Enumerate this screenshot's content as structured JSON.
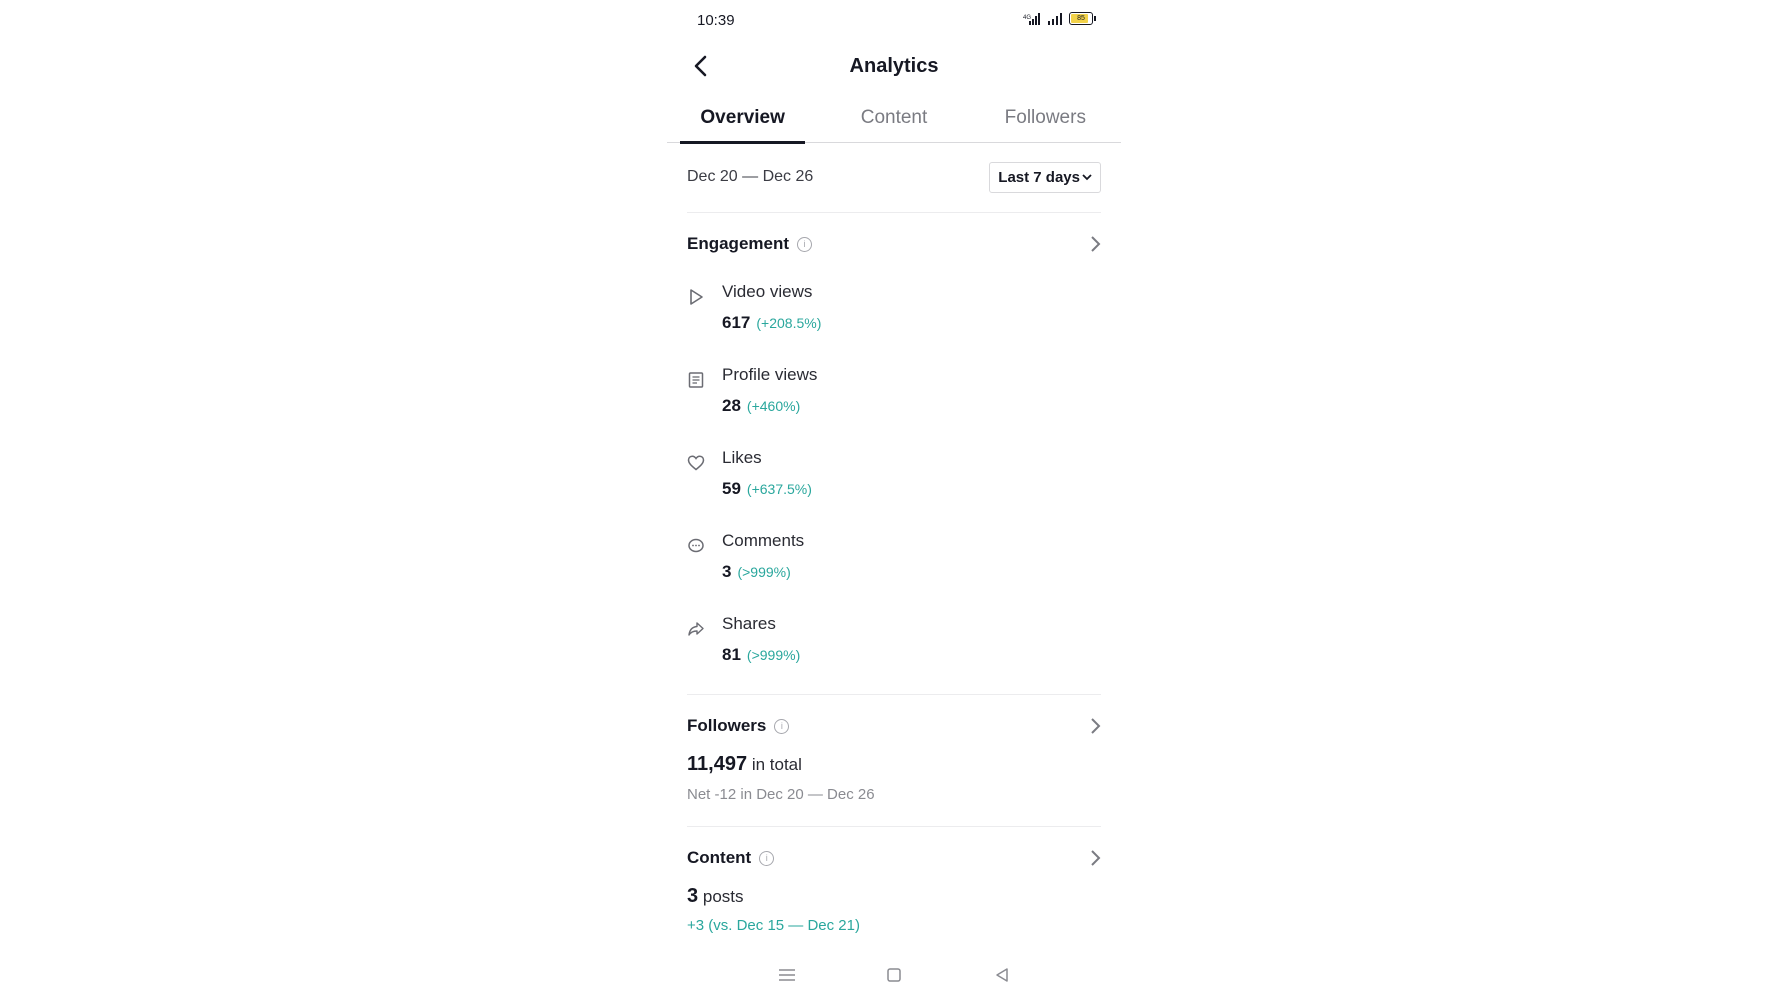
{
  "status_bar": {
    "time": "10:39",
    "battery": "85",
    "network": "4G"
  },
  "header": {
    "title": "Analytics",
    "back_icon": "chevron-left-icon"
  },
  "tabs": [
    {
      "label": "Overview",
      "active": true
    },
    {
      "label": "Content",
      "active": false
    },
    {
      "label": "Followers",
      "active": false
    }
  ],
  "date_filter": {
    "range": "Dec 20 — Dec 26",
    "select_label": "Last 7 days"
  },
  "engagement": {
    "title": "Engagement",
    "metrics": [
      {
        "icon": "play-icon",
        "label": "Video views",
        "value": "617",
        "change": "(+208.5%)"
      },
      {
        "icon": "profile-icon",
        "label": "Profile views",
        "value": "28",
        "change": "(+460%)"
      },
      {
        "icon": "heart-icon",
        "label": "Likes",
        "value": "59",
        "change": "(+637.5%)"
      },
      {
        "icon": "comment-icon",
        "label": "Comments",
        "value": "3",
        "change": "(>999%)"
      },
      {
        "icon": "share-icon",
        "label": "Shares",
        "value": "81",
        "change": "(>999%)"
      }
    ]
  },
  "followers": {
    "title": "Followers",
    "total": "11,497",
    "total_suffix": "in total",
    "net": "Net -12 in Dec 20 — Dec 26"
  },
  "content": {
    "title": "Content",
    "count": "3",
    "count_suffix": "posts",
    "comparison": "+3 (vs. Dec 15 — Dec 21)"
  },
  "colors": {
    "accent_teal": "#2aa79d",
    "text": "#161823",
    "muted": "#8a8b91"
  }
}
